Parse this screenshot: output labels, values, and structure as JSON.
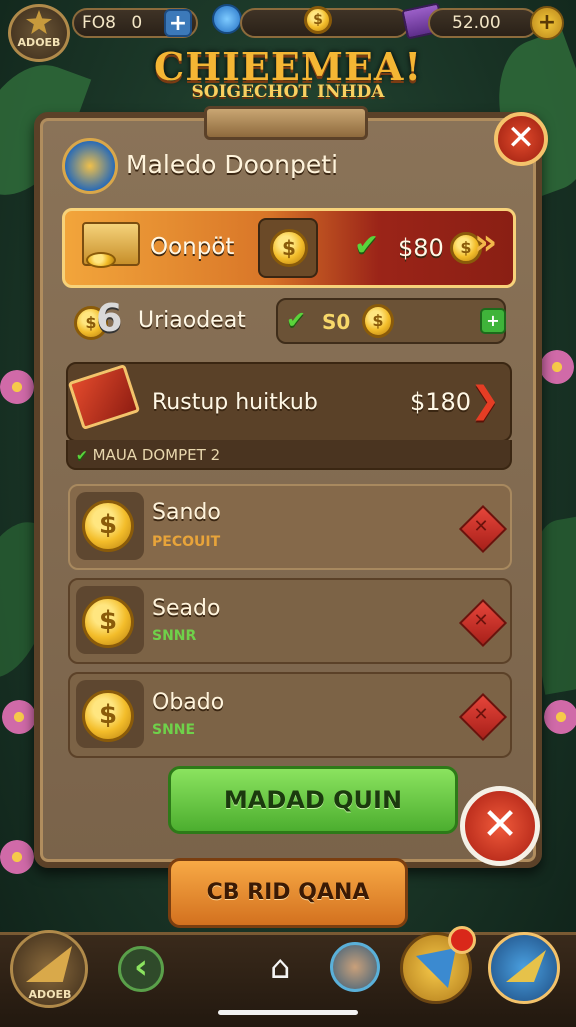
{
  "topbar": {
    "avatar_label": "ADOEB",
    "currency1_label": "FO8",
    "currency1_value": "0",
    "currency1_plus": "+",
    "currency2_value": "52.00",
    "currency2_plus": "+"
  },
  "game": {
    "title": "CHIEEMEA!",
    "subtitle": "SOIGECHOT INHDA"
  },
  "panel": {
    "title": "Maledo Doonpeti",
    "close": "✕",
    "featured": {
      "label": "Oonpöt",
      "check": "✔",
      "price": "$80",
      "arrows": "»"
    },
    "bonus": {
      "number": "6",
      "label": "Uriaodeat",
      "check": "✔",
      "value": "S0",
      "plus": "+"
    },
    "offer": {
      "label": "Rustup huitkub",
      "price": "$180",
      "arrow": "❯",
      "footer": "MAUA DOMPET 2"
    },
    "items": [
      {
        "name": "Sando",
        "sub": "PECOUIT",
        "sub_color": "#e8a43a"
      },
      {
        "name": "Seado",
        "sub": "SNNR",
        "sub_color": "#6fd14a"
      },
      {
        "name": "Obado",
        "sub": "SNNE",
        "sub_color": "#6fd14a"
      }
    ],
    "item_action": "✕",
    "primary_button": "MADAD QUIN",
    "close_bottom": "✕",
    "secondary_button": "CB RID QANA"
  },
  "bottom_nav": {
    "left_label": "ADOEB",
    "back_icon": "‹",
    "home_icon": "⌂"
  }
}
